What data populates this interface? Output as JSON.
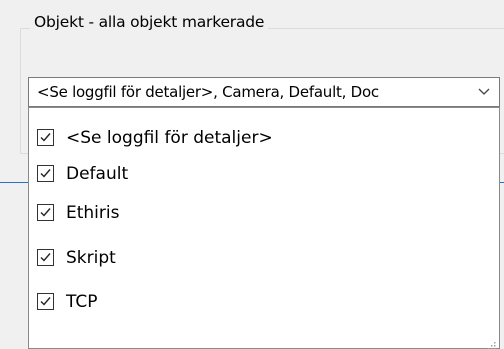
{
  "group": {
    "legend": "Objekt - alla objekt markerade"
  },
  "combo": {
    "value": "<Se loggfil för detaljer>, Camera, Default, Doc",
    "arrow_icon": "chevron-down-icon"
  },
  "list": {
    "items": [
      {
        "label": "<Se loggfil för detaljer>",
        "checked": true
      },
      {
        "label": "Default",
        "checked": true
      },
      {
        "label": "Ethiris",
        "checked": true
      },
      {
        "label": "Skript",
        "checked": true
      },
      {
        "label": "TCP",
        "checked": true
      }
    ],
    "grip_icon": "resize-grip-icon"
  },
  "colors": {
    "accent_line": "#2a6fc9",
    "border": "#7a7a7a",
    "background": "#f0f0f0"
  }
}
